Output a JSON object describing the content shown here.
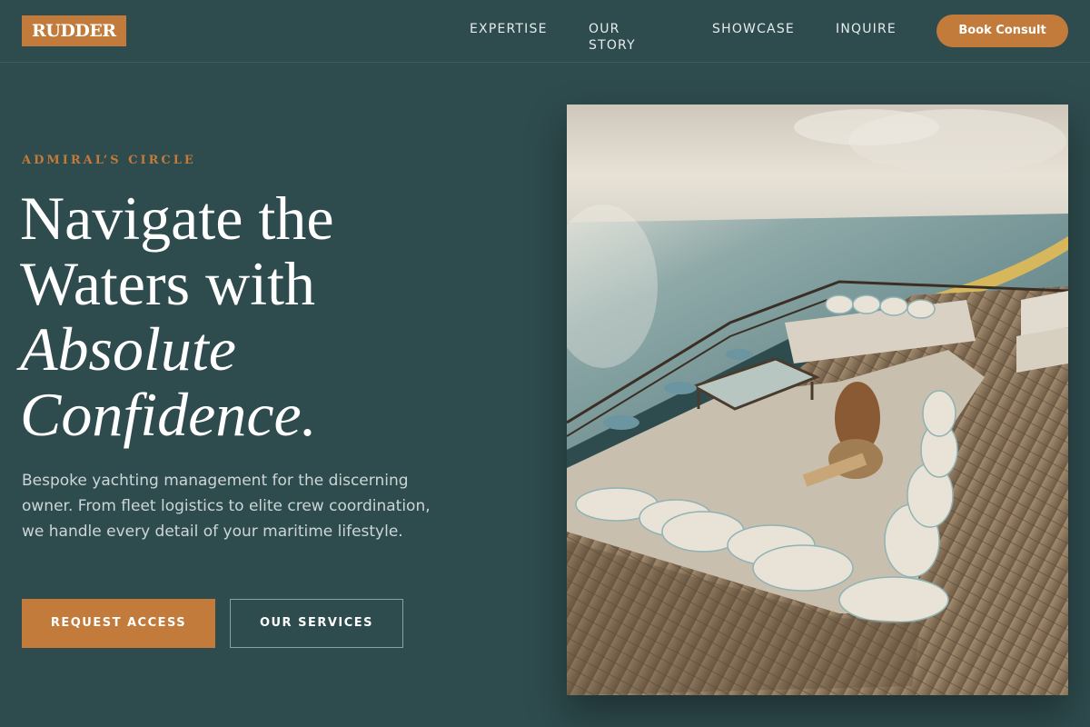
{
  "header": {
    "logo_text": "RUDDER",
    "nav": [
      {
        "label": "EXPERTISE"
      },
      {
        "label": "OUR STORY"
      },
      {
        "label": "SHOWCASE"
      },
      {
        "label": "INQUIRE"
      }
    ],
    "cta_label": "Book Consult"
  },
  "hero": {
    "eyebrow": "ADMIRAL’S CIRCLE",
    "headline_line1": "Navigate the",
    "headline_line2": "Waters with",
    "headline_line3": "Absolute",
    "headline_line4": "Confidence.",
    "description": "Bespoke yachting management for the discerning owner. From fleet logistics to elite crew coordination, we handle every detail of your maritime lifestyle.",
    "primary_button": "REQUEST ACCESS",
    "secondary_button": "OUR SERVICES",
    "image_subject": "yacht-deck-lounge-photo"
  },
  "colors": {
    "background": "#2e4b4d",
    "accent": "#c27b3a",
    "text": "#ffffff",
    "muted_text": "#cdd6d6"
  }
}
